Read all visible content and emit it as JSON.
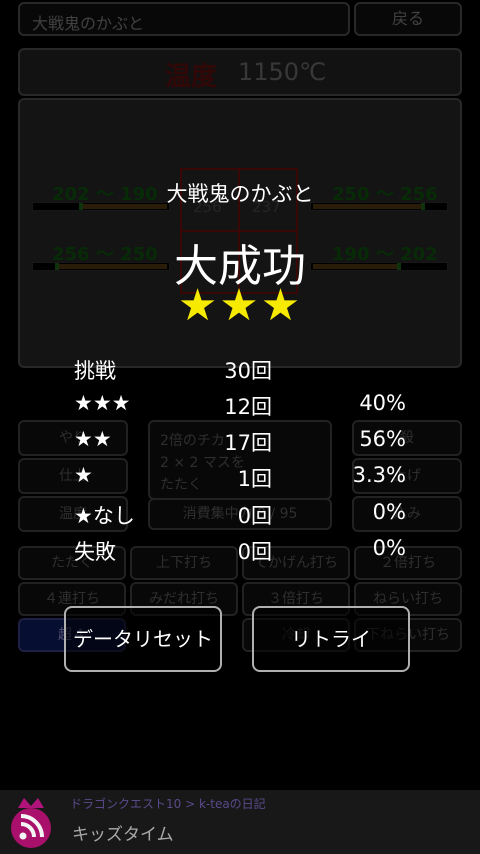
{
  "topbar": {
    "title": "大戦鬼のかぶと",
    "back_label": "戻る"
  },
  "header": {
    "temp_label": "温度",
    "temp_value": "1150℃"
  },
  "board": {
    "gauges": [
      {
        "range": "202 〜 190"
      },
      {
        "range": "250 〜 256"
      },
      {
        "range": "256 〜 250"
      },
      {
        "range": "190 〜 202"
      }
    ],
    "cells": [
      "256",
      "237"
    ]
  },
  "panel": {
    "row1": [
      "やり",
      "2倍のチカ",
      "殺"
    ],
    "row2": [
      "仕上",
      "2 × 2 マスを",
      "上げ"
    ],
    "row2b": "たたく",
    "row3": [
      "温度",
      "消費集中力",
      "8 / 95",
      "込み"
    ]
  },
  "skills": [
    [
      "たたく",
      "上下打ち",
      "てかげん打ち",
      "２倍打ち"
    ],
    [
      "４連打ち",
      "みだれ打ち",
      "３倍打ち",
      "ねらい打ち"
    ],
    [
      "超４",
      "",
      "冷却",
      "下ねらい打ち"
    ]
  ],
  "result": {
    "item_name": "大戦鬼のかぶと",
    "outcome": "大成功",
    "stars": "★★★",
    "stats": [
      {
        "label": "挑戦",
        "count": "30回",
        "pct": ""
      },
      {
        "label": "★★★",
        "count": "12回",
        "pct": "40%"
      },
      {
        "label": "★★",
        "count": "17回",
        "pct": "56%"
      },
      {
        "label": "★",
        "count": "1回",
        "pct": "3.3%"
      },
      {
        "label": "★なし",
        "count": "0回",
        "pct": "0%"
      },
      {
        "label": "失敗",
        "count": "0回",
        "pct": "0%"
      }
    ],
    "reset_label": "データリセット",
    "retry_label": "リトライ"
  },
  "ad": {
    "source": "ドラゴンクエスト10 > k-teaの日記",
    "title": "キッズタイム"
  },
  "colors": {
    "stars": "#f5ea00",
    "background": "#000000"
  }
}
